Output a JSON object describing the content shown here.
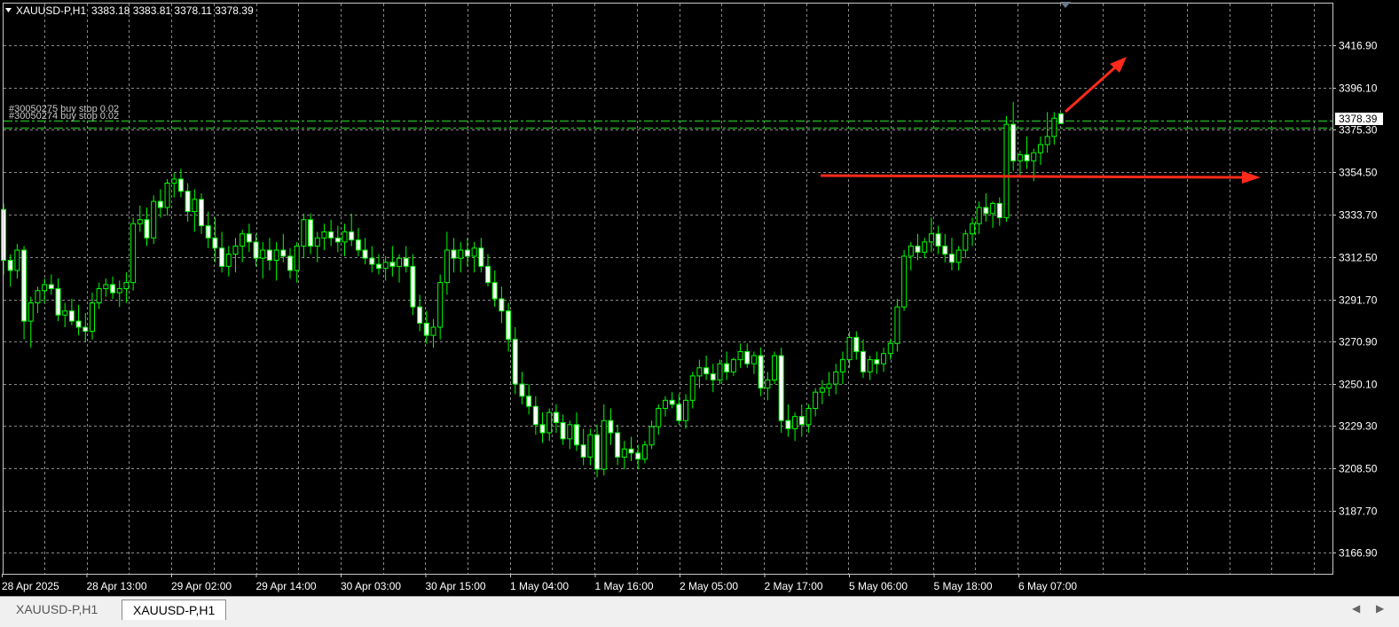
{
  "header": {
    "symbol": "XAUUSD-P,H1",
    "ohlc": "3383.18 3383.81 3378.11 3378.39"
  },
  "current_price_label": "3378.39",
  "order_labels": [
    "#30050275 buy stop 0.02",
    "#30050274 buy stop 0.02"
  ],
  "tabs": [
    {
      "label": "XAUUSD-P,H1",
      "active": false
    },
    {
      "label": "XAUUSD-P,H1",
      "active": true
    }
  ],
  "colors": {
    "background": "#000000",
    "grid": "#8a8a8a",
    "candle": "#00ff00",
    "order_line": "#22aa22",
    "arrow": "#ff2a1a"
  },
  "chart_data": {
    "type": "candlestick",
    "title": "XAUUSD-P,H1",
    "ylim": [
      3156.5,
      3437.5
    ],
    "y_ticks": [
      3416.9,
      3396.1,
      3375.3,
      3354.5,
      3333.7,
      3312.5,
      3291.7,
      3270.9,
      3250.1,
      3229.3,
      3208.5,
      3187.7,
      3166.9
    ],
    "x_tick_labels": [
      "28 Apr 2025",
      "28 Apr 13:00",
      "29 Apr 02:00",
      "29 Apr 14:00",
      "30 Apr 03:00",
      "30 Apr 15:00",
      "1 May 04:00",
      "1 May 16:00",
      "2 May 05:00",
      "2 May 17:00",
      "5 May 06:00",
      "5 May 18:00",
      "6 May 07:00"
    ],
    "grid": true,
    "current_price": 3378.39,
    "order_levels": [
      3380.0,
      3376.5
    ],
    "candles": [
      [
        3336,
        3339,
        3304,
        3311
      ],
      [
        3311,
        3314,
        3298,
        3306
      ],
      [
        3306,
        3319,
        3302,
        3316
      ],
      [
        3316,
        3318,
        3272,
        3281
      ],
      [
        3281,
        3293,
        3268,
        3290
      ],
      [
        3290,
        3298,
        3285,
        3296
      ],
      [
        3296,
        3302,
        3290,
        3299
      ],
      [
        3299,
        3304,
        3294,
        3297
      ],
      [
        3297,
        3302,
        3281,
        3284
      ],
      [
        3284,
        3290,
        3278,
        3286
      ],
      [
        3286,
        3292,
        3279,
        3281
      ],
      [
        3281,
        3289,
        3274,
        3278
      ],
      [
        3278,
        3285,
        3271,
        3276
      ],
      [
        3276,
        3295,
        3272,
        3290
      ],
      [
        3290,
        3300,
        3287,
        3297
      ],
      [
        3297,
        3302,
        3293,
        3299
      ],
      [
        3299,
        3303,
        3292,
        3295
      ],
      [
        3295,
        3301,
        3288,
        3297
      ],
      [
        3297,
        3305,
        3290,
        3300
      ],
      [
        3300,
        3332,
        3296,
        3329
      ],
      [
        3329,
        3338,
        3325,
        3331
      ],
      [
        3331,
        3337,
        3318,
        3322
      ],
      [
        3322,
        3343,
        3319,
        3340
      ],
      [
        3340,
        3346,
        3332,
        3337
      ],
      [
        3337,
        3351,
        3333,
        3349
      ],
      [
        3349,
        3354,
        3342,
        3351
      ],
      [
        3351,
        3356,
        3342,
        3345
      ],
      [
        3345,
        3349,
        3330,
        3335
      ],
      [
        3335,
        3346,
        3325,
        3341
      ],
      [
        3341,
        3344,
        3324,
        3328
      ],
      [
        3328,
        3335,
        3317,
        3322
      ],
      [
        3322,
        3332,
        3310,
        3317
      ],
      [
        3317,
        3325,
        3305,
        3308
      ],
      [
        3308,
        3318,
        3303,
        3314
      ],
      [
        3314,
        3322,
        3305,
        3318
      ],
      [
        3318,
        3326,
        3310,
        3324
      ],
      [
        3324,
        3329,
        3315,
        3320
      ],
      [
        3320,
        3324,
        3308,
        3312
      ],
      [
        3312,
        3320,
        3302,
        3316
      ],
      [
        3316,
        3322,
        3306,
        3311
      ],
      [
        3311,
        3320,
        3301,
        3316
      ],
      [
        3316,
        3324,
        3310,
        3313
      ],
      [
        3313,
        3317,
        3302,
        3306
      ],
      [
        3306,
        3320,
        3300,
        3318
      ],
      [
        3318,
        3334,
        3312,
        3331
      ],
      [
        3331,
        3334,
        3314,
        3318
      ],
      [
        3318,
        3325,
        3310,
        3322
      ],
      [
        3322,
        3329,
        3316,
        3325
      ],
      [
        3325,
        3331,
        3318,
        3322
      ],
      [
        3322,
        3328,
        3315,
        3320
      ],
      [
        3320,
        3329,
        3313,
        3325
      ],
      [
        3325,
        3334,
        3318,
        3321
      ],
      [
        3321,
        3327,
        3313,
        3316
      ],
      [
        3316,
        3322,
        3309,
        3312
      ],
      [
        3312,
        3318,
        3305,
        3309
      ],
      [
        3309,
        3314,
        3304,
        3307
      ],
      [
        3307,
        3313,
        3301,
        3310
      ],
      [
        3310,
        3318,
        3303,
        3308
      ],
      [
        3308,
        3314,
        3300,
        3312
      ],
      [
        3312,
        3318,
        3305,
        3308
      ],
      [
        3308,
        3314,
        3284,
        3288
      ],
      [
        3288,
        3294,
        3276,
        3280
      ],
      [
        3280,
        3286,
        3270,
        3274
      ],
      [
        3274,
        3282,
        3268,
        3278
      ],
      [
        3278,
        3304,
        3272,
        3300
      ],
      [
        3300,
        3325,
        3294,
        3316
      ],
      [
        3316,
        3322,
        3305,
        3312
      ],
      [
        3312,
        3320,
        3305,
        3316
      ],
      [
        3316,
        3322,
        3308,
        3313
      ],
      [
        3313,
        3320,
        3305,
        3317
      ],
      [
        3317,
        3322,
        3305,
        3308
      ],
      [
        3308,
        3314,
        3298,
        3300
      ],
      [
        3300,
        3306,
        3288,
        3292
      ],
      [
        3292,
        3298,
        3280,
        3286
      ],
      [
        3286,
        3290,
        3266,
        3272
      ],
      [
        3272,
        3278,
        3245,
        3250
      ],
      [
        3250,
        3256,
        3240,
        3244
      ],
      [
        3244,
        3250,
        3235,
        3239
      ],
      [
        3239,
        3244,
        3225,
        3230
      ],
      [
        3230,
        3236,
        3221,
        3226
      ],
      [
        3226,
        3238,
        3222,
        3236
      ],
      [
        3236,
        3240,
        3226,
        3231
      ],
      [
        3231,
        3235,
        3220,
        3223
      ],
      [
        3223,
        3232,
        3218,
        3230
      ],
      [
        3230,
        3236,
        3217,
        3220
      ],
      [
        3220,
        3228,
        3210,
        3214
      ],
      [
        3214,
        3228,
        3210,
        3225
      ],
      [
        3225,
        3230,
        3204,
        3208
      ],
      [
        3208,
        3240,
        3205,
        3232
      ],
      [
        3232,
        3238,
        3220,
        3226
      ],
      [
        3226,
        3230,
        3210,
        3214
      ],
      [
        3214,
        3222,
        3208,
        3218
      ],
      [
        3218,
        3224,
        3212,
        3216
      ],
      [
        3216,
        3220,
        3208,
        3213
      ],
      [
        3213,
        3222,
        3211,
        3220
      ],
      [
        3220,
        3232,
        3218,
        3229
      ],
      [
        3229,
        3240,
        3225,
        3238
      ],
      [
        3238,
        3244,
        3234,
        3242
      ],
      [
        3242,
        3246,
        3238,
        3240
      ],
      [
        3240,
        3245,
        3230,
        3232
      ],
      [
        3232,
        3245,
        3228,
        3242
      ],
      [
        3242,
        3256,
        3238,
        3254
      ],
      [
        3254,
        3262,
        3248,
        3258
      ],
      [
        3258,
        3264,
        3252,
        3255
      ],
      [
        3255,
        3260,
        3246,
        3252
      ],
      [
        3252,
        3262,
        3250,
        3260
      ],
      [
        3260,
        3266,
        3252,
        3256
      ],
      [
        3256,
        3263,
        3254,
        3262
      ],
      [
        3262,
        3270,
        3258,
        3266
      ],
      [
        3266,
        3270,
        3258,
        3260
      ],
      [
        3260,
        3266,
        3255,
        3264
      ],
      [
        3264,
        3268,
        3244,
        3248
      ],
      [
        3248,
        3256,
        3242,
        3252
      ],
      [
        3252,
        3266,
        3250,
        3264
      ],
      [
        3264,
        3268,
        3226,
        3232
      ],
      [
        3232,
        3240,
        3224,
        3228
      ],
      [
        3228,
        3236,
        3222,
        3234
      ],
      [
        3234,
        3240,
        3224,
        3230
      ],
      [
        3230,
        3240,
        3226,
        3238
      ],
      [
        3238,
        3248,
        3234,
        3246
      ],
      [
        3246,
        3252,
        3240,
        3248
      ],
      [
        3248,
        3256,
        3244,
        3250
      ],
      [
        3250,
        3260,
        3245,
        3256
      ],
      [
        3256,
        3266,
        3250,
        3262
      ],
      [
        3262,
        3276,
        3258,
        3273
      ],
      [
        3273,
        3276,
        3262,
        3266
      ],
      [
        3266,
        3272,
        3253,
        3256
      ],
      [
        3256,
        3264,
        3252,
        3262
      ],
      [
        3262,
        3266,
        3255,
        3260
      ],
      [
        3260,
        3268,
        3256,
        3265
      ],
      [
        3265,
        3272,
        3262,
        3270
      ],
      [
        3270,
        3292,
        3266,
        3288
      ],
      [
        3288,
        3316,
        3286,
        3313
      ],
      [
        3313,
        3320,
        3306,
        3318
      ],
      [
        3318,
        3324,
        3311,
        3315
      ],
      [
        3315,
        3322,
        3312,
        3320
      ],
      [
        3320,
        3332,
        3315,
        3324
      ],
      [
        3324,
        3328,
        3314,
        3318
      ],
      [
        3318,
        3324,
        3310,
        3314
      ],
      [
        3314,
        3322,
        3306,
        3310
      ],
      [
        3310,
        3318,
        3306,
        3316
      ],
      [
        3316,
        3326,
        3312,
        3324
      ],
      [
        3324,
        3332,
        3318,
        3329
      ],
      [
        3329,
        3340,
        3324,
        3337
      ],
      [
        3337,
        3344,
        3330,
        3334
      ],
      [
        3334,
        3340,
        3327,
        3339
      ],
      [
        3339,
        3342,
        3328,
        3332
      ],
      [
        3332,
        3382,
        3330,
        3378
      ],
      [
        3378,
        3389,
        3355,
        3360
      ],
      [
        3360,
        3365,
        3352,
        3363
      ],
      [
        3363,
        3372,
        3356,
        3360
      ],
      [
        3360,
        3366,
        3350,
        3364
      ],
      [
        3364,
        3372,
        3358,
        3368
      ],
      [
        3368,
        3384,
        3364,
        3372
      ],
      [
        3372,
        3384,
        3368,
        3381
      ],
      [
        3383.18,
        3383.81,
        3378.11,
        3378.39
      ]
    ]
  }
}
